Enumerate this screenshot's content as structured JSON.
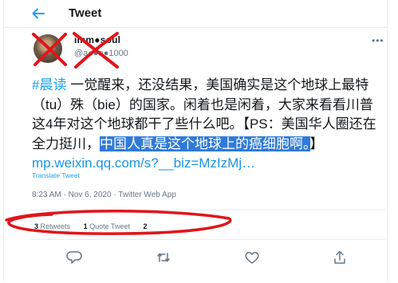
{
  "header": {
    "title": "Tweet"
  },
  "user": {
    "name": "imm●soul",
    "handle": "@a●●a●1000"
  },
  "tweet": {
    "hashtag": "#晨读",
    "text_part1": " 一觉醒来，还没结果，美国确实是这个地球上最特（tu）殊（bie）的国家。闲着也是闲着，大家来看看川普这4年对这个地球都干了些什么吧。【PS：美国华人圈还在全力挺川，",
    "highlighted": "中国人真是这个地球上的癌细胞啊。",
    "text_part2": "】",
    "link": "mp.weixin.qq.com/s?__biz=MzIzMj…",
    "translate": "Translate Tweet",
    "meta": "8:23 AM · Nov 6, 2020 · Twitter Web App"
  },
  "stats": {
    "retweets_count": "3",
    "retweets_label": "Retweets",
    "quotes_count": "1",
    "quotes_label": "Quote Tweet",
    "likes_count": "2"
  },
  "colors": {
    "accent": "#1da1f2",
    "highlight": "#2f7ad9",
    "scribble": "#e0161b"
  },
  "icons": [
    "back-arrow-icon",
    "more-icon",
    "reply-icon",
    "retweet-icon",
    "like-icon",
    "share-icon"
  ]
}
